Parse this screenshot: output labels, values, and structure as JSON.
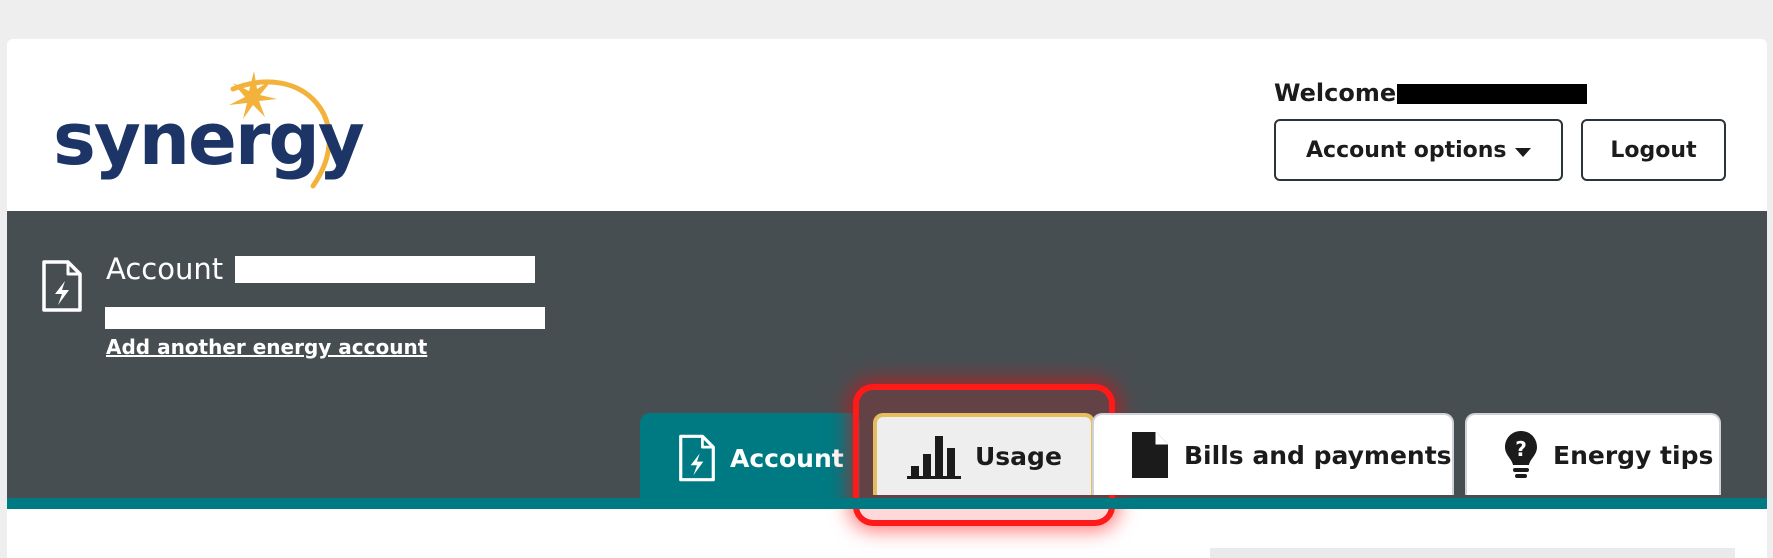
{
  "header": {
    "logo_text": "synergy",
    "welcome_label": "Welcome",
    "account_options_label": "Account options",
    "logout_label": "Logout"
  },
  "account": {
    "title": "Account",
    "add_account_link": "Add another energy account"
  },
  "tabs": [
    {
      "label": "Account",
      "icon": "document-lightning-icon",
      "state": "selected"
    },
    {
      "label": "Usage",
      "icon": "bar-chart-icon",
      "state": "highlighted"
    },
    {
      "label": "Bills and payments",
      "icon": "document-icon",
      "state": "default"
    },
    {
      "label": "Energy tips",
      "icon": "lightbulb-icon",
      "state": "default"
    }
  ],
  "colors": {
    "brand_navy": "#1d3566",
    "brand_gold": "#f3b23c",
    "band_gray": "#474e52",
    "teal": "#007a82",
    "highlight_red": "#ff1a1a"
  }
}
